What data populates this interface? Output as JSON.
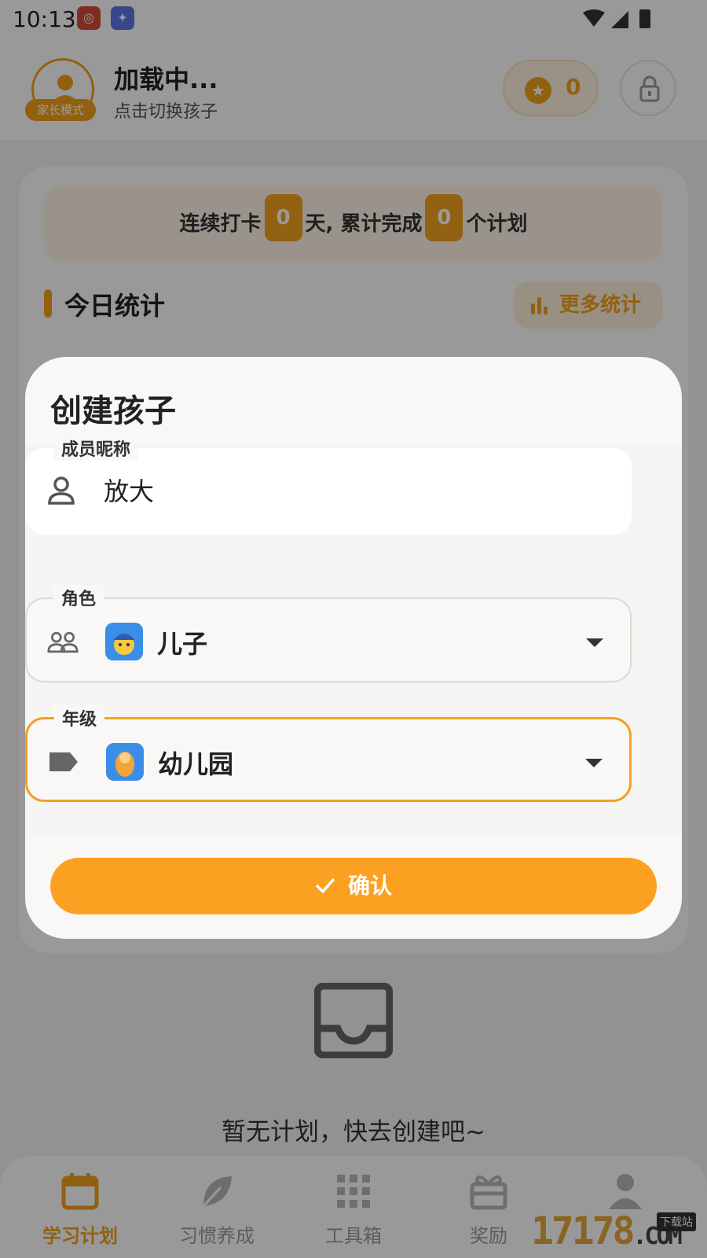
{
  "status_bar": {
    "time": "10:13"
  },
  "header": {
    "title": "加载中...",
    "subtitle": "点击切换孩子",
    "mode_badge": "家长模式",
    "stars": "0"
  },
  "summary": {
    "prefix": "连续打卡",
    "streak_days": "0",
    "middle": "天, 累计完成",
    "completed_plans": "0",
    "suffix": "个计划"
  },
  "stats": {
    "title": "今日统计",
    "more_label": "更多统计"
  },
  "empty_state": {
    "text": "暂无计划，快去创建吧~"
  },
  "tabs": [
    {
      "label": "学习计划",
      "icon": "calendar-icon",
      "active": true
    },
    {
      "label": "习惯养成",
      "icon": "leaf-icon",
      "active": false
    },
    {
      "label": "工具箱",
      "icon": "grid-icon",
      "active": false
    },
    {
      "label": "奖励",
      "icon": "gift-icon",
      "active": false
    },
    {
      "label": "",
      "icon": "person-icon",
      "active": false
    }
  ],
  "watermark": {
    "text": "17178",
    "domain": ".COM",
    "tag": "下载站"
  },
  "dialog": {
    "title": "创建孩子",
    "nickname": {
      "label": "成员昵称",
      "value": "放大"
    },
    "role": {
      "label": "角色",
      "value": "儿子"
    },
    "grade": {
      "label": "年级",
      "value": "幼儿园"
    },
    "confirm_label": "确认"
  },
  "colors": {
    "accent": "#f2a21d",
    "confirm": "#fba020",
    "badge_blue": "#3b8ee8"
  }
}
